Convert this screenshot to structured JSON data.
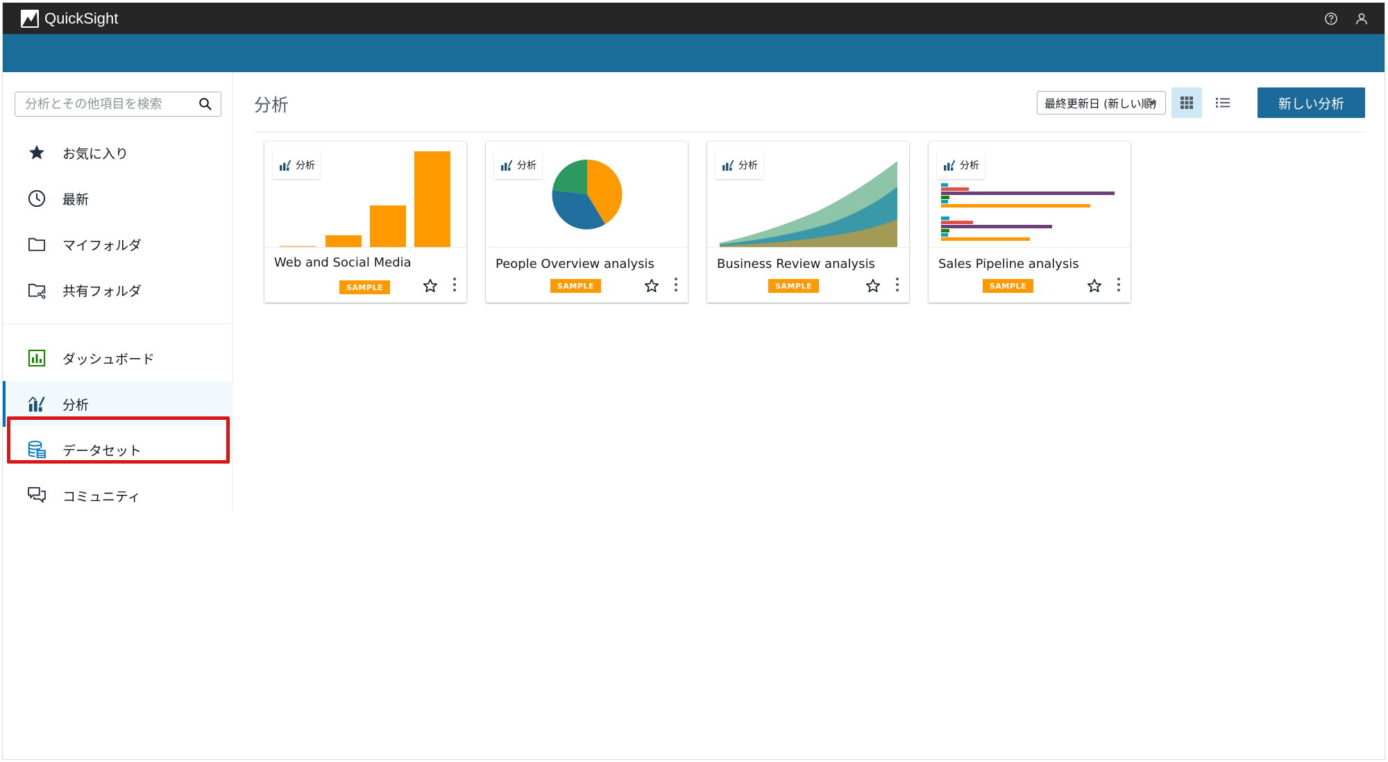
{
  "app": {
    "name": "QuickSight"
  },
  "header": {
    "help_icon": "help-circle-icon",
    "user_icon": "user-icon"
  },
  "sidebar": {
    "search_placeholder": "分析とその他項目を検索",
    "group1": [
      {
        "label": "お気に入り",
        "icon": "star-icon"
      },
      {
        "label": "最新",
        "icon": "clock-icon"
      },
      {
        "label": "マイフォルダ",
        "icon": "folder-icon"
      },
      {
        "label": "共有フォルダ",
        "icon": "shared-folder-icon"
      }
    ],
    "group2": [
      {
        "label": "ダッシュボード",
        "icon": "dashboard-icon"
      },
      {
        "label": "分析",
        "icon": "analysis-icon",
        "active": true
      },
      {
        "label": "データセット",
        "icon": "dataset-icon",
        "highlighted": true
      },
      {
        "label": "コミュニティ",
        "icon": "community-icon"
      }
    ]
  },
  "main": {
    "title": "分析",
    "sort_label": "最終更新日 (新しい順)",
    "new_button": "新しい分析",
    "view_mode": "grid"
  },
  "cards": [
    {
      "tag": "分析",
      "title": "Web and Social Media",
      "badge": "SAMPLE",
      "preview": "bar"
    },
    {
      "tag": "分析",
      "title": "People Overview analysis",
      "badge": "SAMPLE",
      "preview": "pie"
    },
    {
      "tag": "分析",
      "title": "Business Review analysis",
      "badge": "SAMPLE",
      "preview": "area"
    },
    {
      "tag": "分析",
      "title": "Sales Pipeline analysis",
      "badge": "SAMPLE",
      "preview": "hbar"
    }
  ],
  "colors": {
    "topbar": "#262626",
    "band": "#1a6d99",
    "accent": "#0073bb",
    "sample_badge": "#ff9900",
    "highlight": "#d91515"
  }
}
